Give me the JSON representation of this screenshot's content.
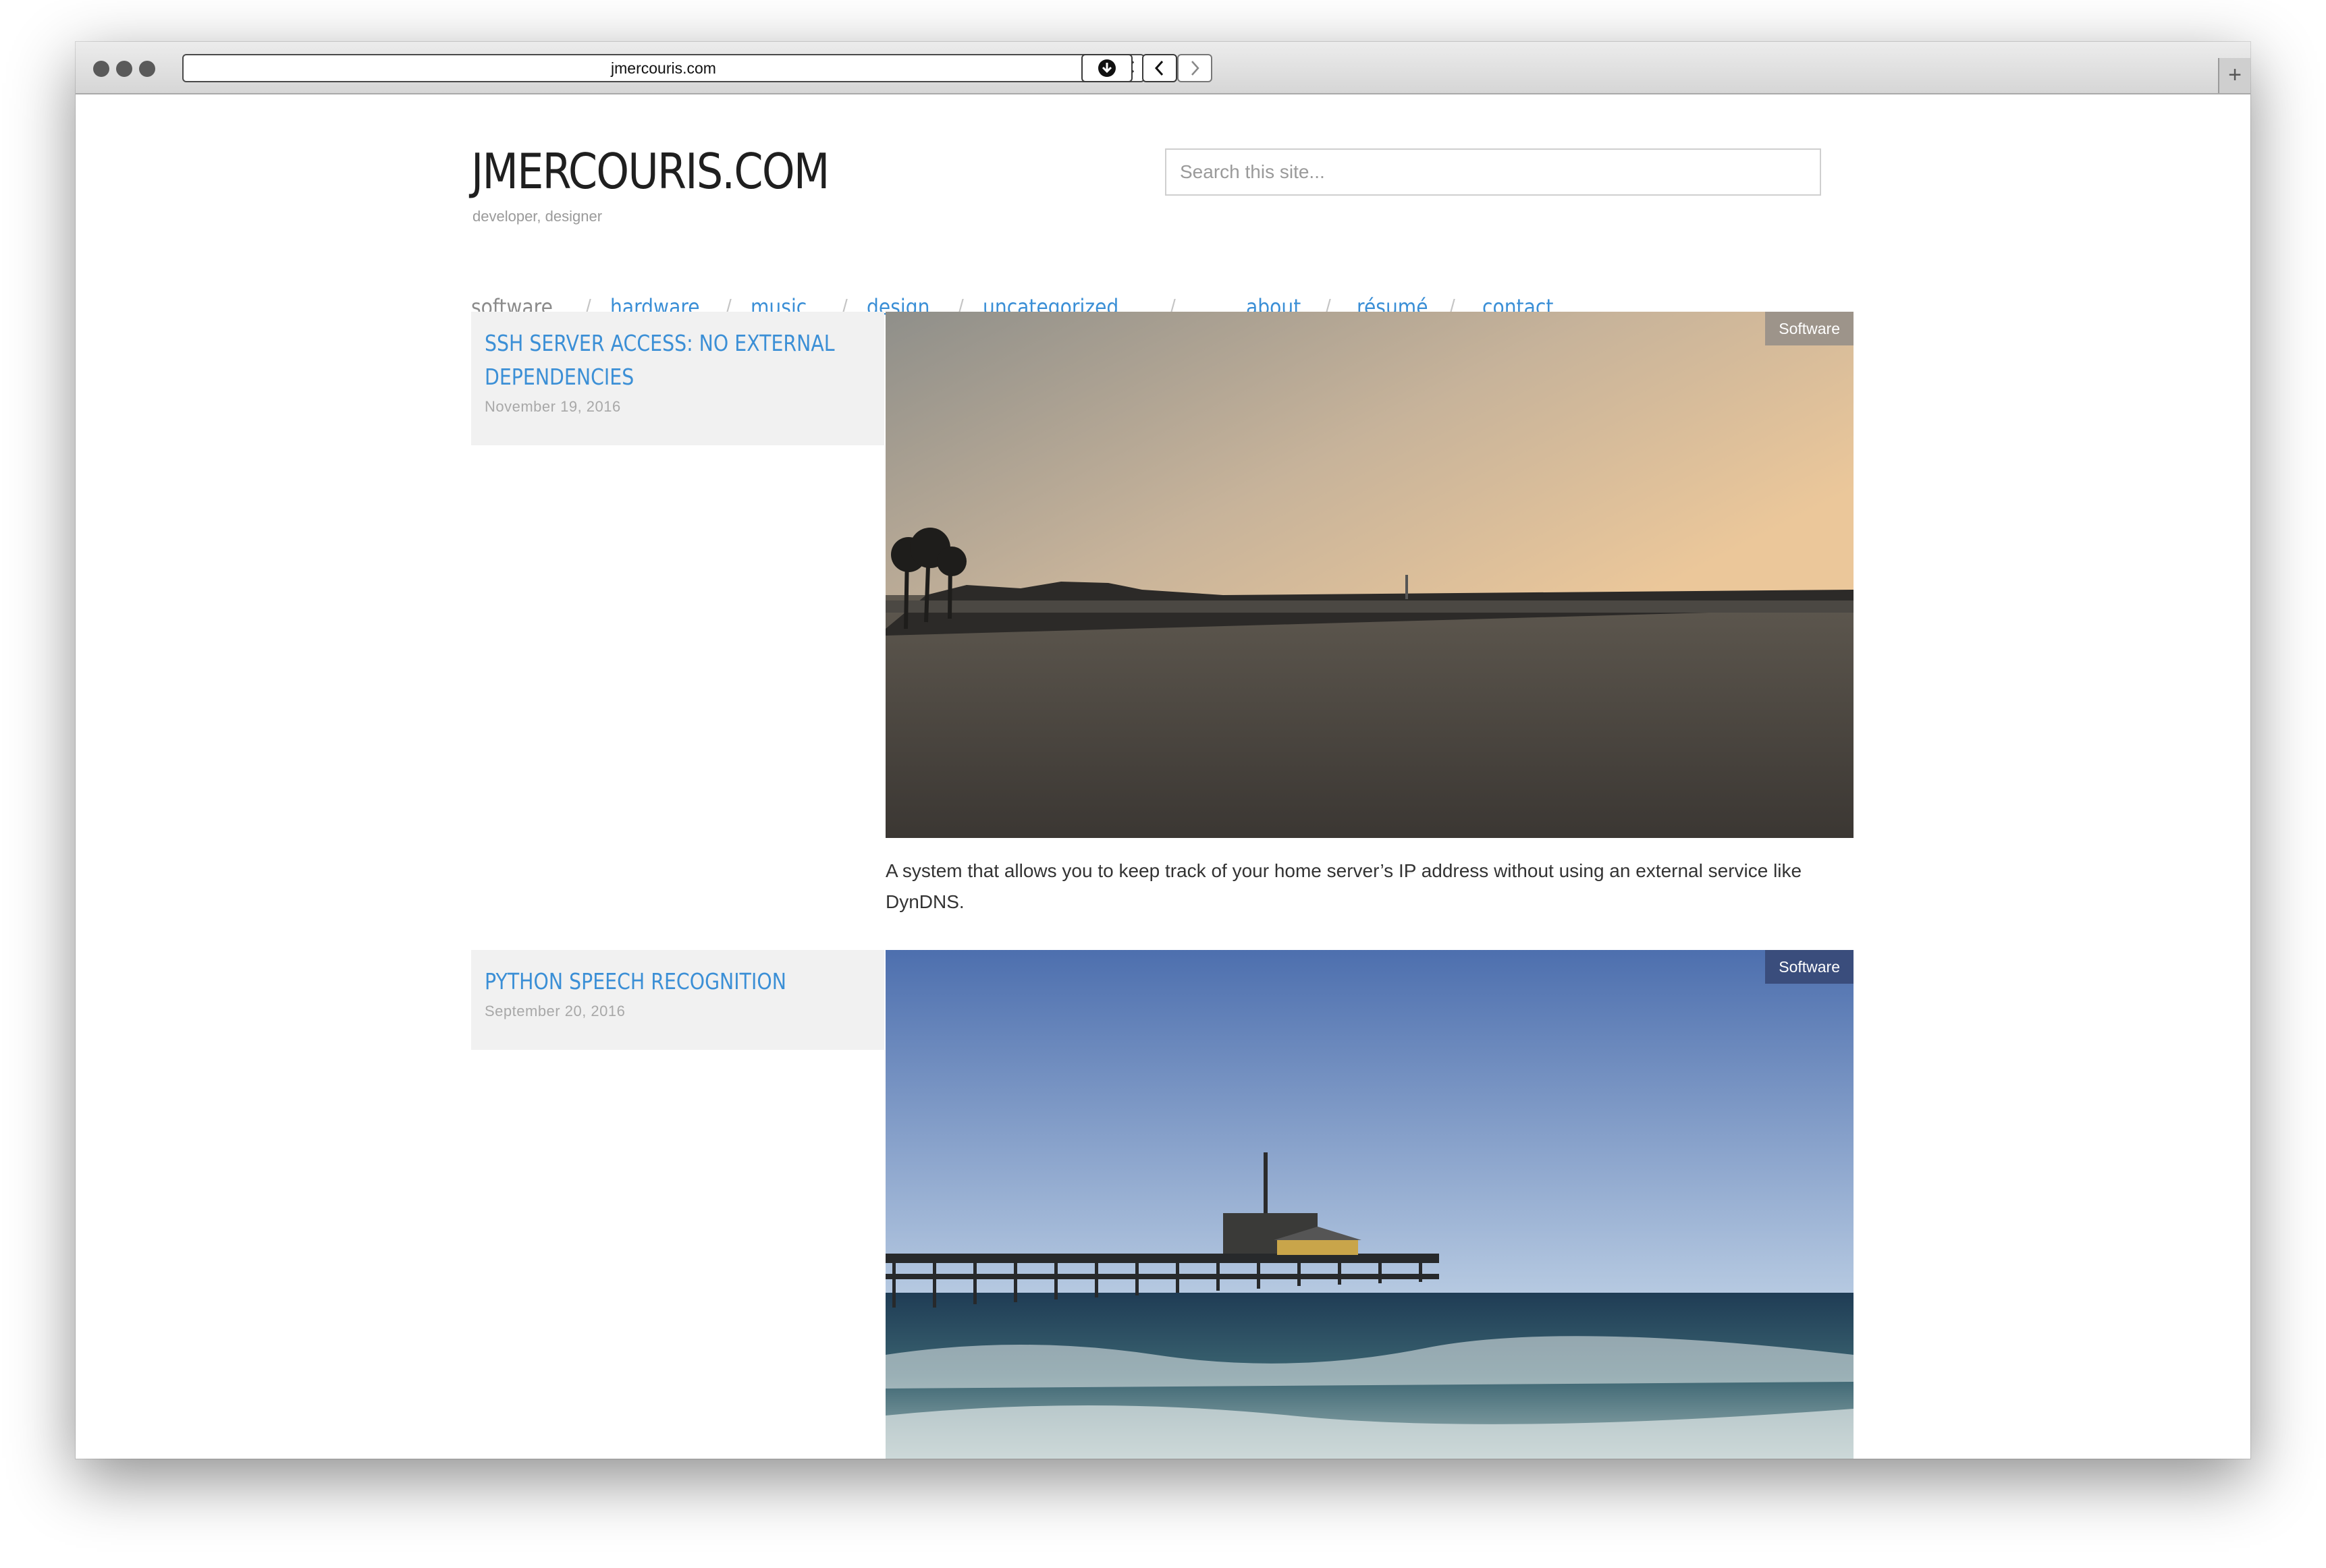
{
  "browser": {
    "url": "jmercouris.com"
  },
  "site": {
    "title": "JMERCOURIS.COM",
    "tagline": "developer, designer",
    "search_placeholder": "Search this site..."
  },
  "nav": {
    "items": [
      {
        "label": "software",
        "current": true
      },
      {
        "label": "hardware"
      },
      {
        "label": "music"
      },
      {
        "label": "design"
      },
      {
        "label": "uncategorized"
      },
      {
        "label": "about"
      },
      {
        "label": "résumé"
      },
      {
        "label": "contact"
      }
    ],
    "separator": "/"
  },
  "posts": [
    {
      "title": "SSH SERVER ACCESS: NO EXTERNAL DEPENDENCIES",
      "date": "November 19, 2016",
      "category": "Software",
      "excerpt": "A system that allows you to keep track of your home server’s IP address without using an external service like DynDNS.",
      "badge_color": "#9d948a"
    },
    {
      "title": "PYTHON SPEECH RECOGNITION",
      "date": "September 20, 2016",
      "category": "Software",
      "badge_color": "#3a4d7c"
    }
  ],
  "icons": {
    "close": "close-icon",
    "download": "download-icon",
    "back": "chevron-left-icon",
    "forward": "chevron-right-icon",
    "new_tab": "plus-icon"
  }
}
